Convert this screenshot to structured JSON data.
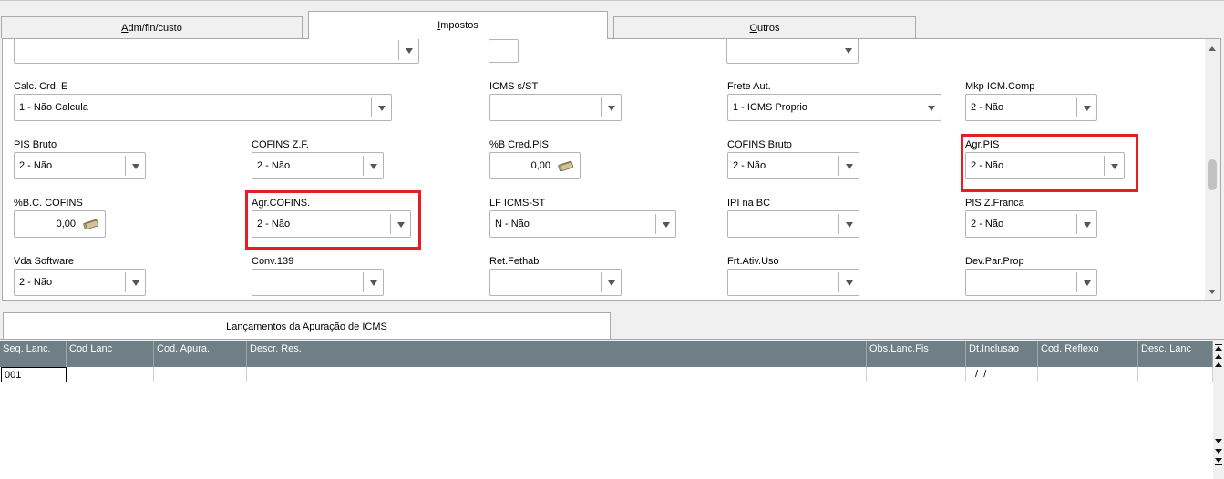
{
  "tabs": [
    {
      "label": "Adm/fin/custo",
      "accel": "A",
      "rest": "dm/fin/custo"
    },
    {
      "label": "Impostos",
      "accel": "I",
      "rest": "mpostos"
    },
    {
      "label": "Outros",
      "accel": "O",
      "rest": "utros"
    }
  ],
  "form": {
    "row0": {
      "combo1": "",
      "box2": "",
      "combo3": ""
    },
    "calc_crd_e": {
      "label": "Calc. Crd. E",
      "value": "1 - Não Calcula"
    },
    "icms_s_st": {
      "label": "ICMS s/ST",
      "value": ""
    },
    "frete_aut": {
      "label": "Frete Aut.",
      "value": "1 - ICMS Proprio"
    },
    "mkp_icm_comp": {
      "label": "Mkp ICM.Comp",
      "value": "2 - Não"
    },
    "pis_bruto": {
      "label": "PIS Bruto",
      "value": "2 - Não"
    },
    "cofins_zf": {
      "label": "COFINS Z.F.",
      "value": "2 - Não"
    },
    "b_cred_pis": {
      "label": "%B Cred.PIS",
      "value": "0,00"
    },
    "cofins_bruto": {
      "label": "COFINS Bruto",
      "value": "2 - Não"
    },
    "agr_pis": {
      "label": "Agr.PIS",
      "value": "2 - Não"
    },
    "bc_cofins": {
      "label": "%B.C. COFINS",
      "value": "0,00"
    },
    "agr_cofins": {
      "label": "Agr.COFINS.",
      "value": "2 - Não"
    },
    "lf_icms_st": {
      "label": "LF ICMS-ST",
      "value": "N - Não"
    },
    "ipi_na_bc": {
      "label": "IPI na BC",
      "value": ""
    },
    "pis_z_franca": {
      "label": "PIS Z.Franca",
      "value": "2 - Não"
    },
    "vda_software": {
      "label": "Vda Software",
      "value": "2 - Não"
    },
    "conv_139": {
      "label": "Conv.139",
      "value": ""
    },
    "ret_fethab": {
      "label": "Ret.Fethab",
      "value": ""
    },
    "frt_ativ_uso": {
      "label": "Frt.Ativ.Uso",
      "value": ""
    },
    "dev_par_prop": {
      "label": "Dev.Par.Prop",
      "value": ""
    }
  },
  "bottom_tab": {
    "label": "Lançamentos da Apuração de ICMS"
  },
  "grid": {
    "columns": [
      "Seq. Lanc.",
      "Cod Lanc",
      "Cod. Apura.",
      "Descr. Res.",
      "Obs.Lanc.Fis",
      "Dt.Inclusao",
      "Cod. Reflexo",
      "Desc. Lanc"
    ],
    "rows": [
      [
        "001",
        "",
        "",
        "",
        "",
        " /  / ",
        "",
        ""
      ]
    ]
  },
  "colors": {
    "header_bg": "#6e7f86",
    "highlight": "#e31e24",
    "panel_bg": "#ffffff",
    "window_bg": "#f0f0f0"
  },
  "icons": [
    "dropdown-arrow-icon",
    "money-icon",
    "scroll-up-icon",
    "scroll-down-icon"
  ]
}
